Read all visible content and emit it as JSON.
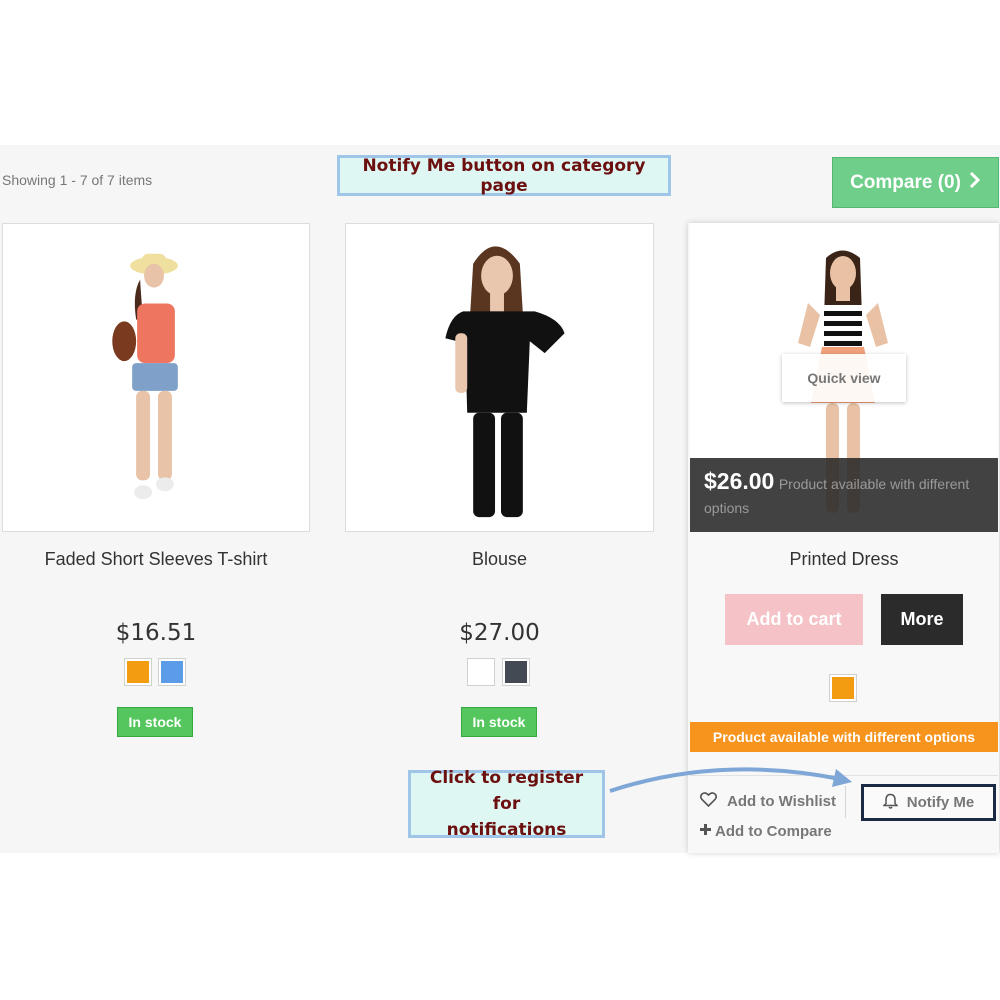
{
  "header": {
    "showing_text": "Showing 1 - 7 of 7 items",
    "compare_label": "Compare (0)"
  },
  "annotations": {
    "top_callout": "Notify Me button on category page",
    "bottom_callout_line1": "Click to register for",
    "bottom_callout_line2": "notifications"
  },
  "products": [
    {
      "name": "Faded Short Sleeves T-shirt",
      "price": "$16.51",
      "colors": [
        "#f39c12",
        "#5b9be8"
      ],
      "stock": "In stock"
    },
    {
      "name": "Blouse",
      "price": "$27.00",
      "colors": [
        "#ffffff",
        "#434a54"
      ],
      "stock": "In stock"
    },
    {
      "name": "Printed Dress",
      "price": "$26.00",
      "overlay_text": "Product available with different options",
      "quick_view": "Quick view",
      "add_to_cart": "Add to cart",
      "more": "More",
      "colors": [
        "#f39c12"
      ],
      "availability": "Product available with different options",
      "wishlist": "Add to Wishlist",
      "notify": "Notify Me",
      "add_compare": "Add to Compare"
    }
  ],
  "theme": {
    "panel_bg": "#f6f6f6",
    "compare_green": "#6fce8a",
    "stock_green": "#55c65e",
    "orange": "#f7941d",
    "add_cart_pink": "#f4c2c7",
    "dark": "#2b2b2b",
    "callout_bg": "#dff7f3",
    "callout_border": "#9fc5e8",
    "callout_text": "#6b0f0f"
  }
}
